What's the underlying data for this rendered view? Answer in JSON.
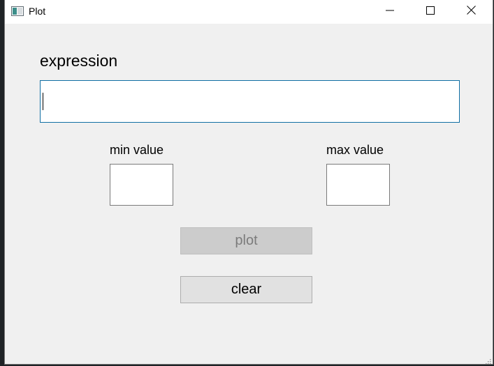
{
  "window": {
    "title": "Plot",
    "icon": "app-window-icon",
    "controls": {
      "minimize": "minimize-icon",
      "maximize": "maximize-icon",
      "close": "close-icon"
    }
  },
  "form": {
    "expression_label": "expression",
    "expression_value": "",
    "min_label": "min value",
    "min_value": "",
    "max_label": "max value",
    "max_value": "",
    "plot_button": "plot",
    "plot_enabled": false,
    "clear_button": "clear"
  },
  "colors": {
    "focus_border": "#0f6ea3",
    "disabled_button_bg": "#cccccc",
    "disabled_button_text": "#7b7b7b",
    "button_bg": "#e1e1e1",
    "window_bg": "#f0f0f0"
  }
}
